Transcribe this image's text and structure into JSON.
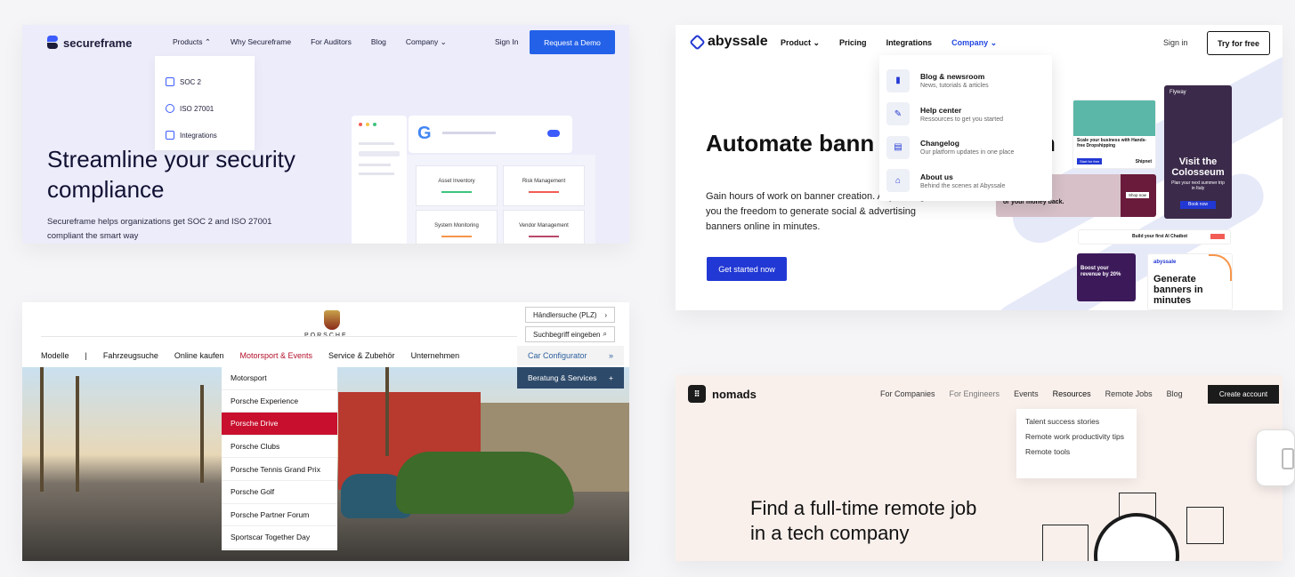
{
  "secureframe": {
    "brand": "secureframe",
    "nav": [
      "Products ⌃",
      "Why Secureframe",
      "For Auditors",
      "Blog",
      "Company ⌄"
    ],
    "sign_in": "Sign In",
    "cta": "Request a Demo",
    "dropdown": [
      "SOC 2",
      "ISO 27001",
      "Integrations"
    ],
    "headline": "Streamline your security compliance",
    "subtext": "Secureframe helps organizations get SOC 2 and ISO 27001 compliant the smart way",
    "tiles": [
      "Asset Inventory",
      "Risk Management",
      "System Monitoring",
      "Vendor Management"
    ],
    "colors": {
      "accent": "#2361e8",
      "bg": "#ececfa"
    }
  },
  "abyssale": {
    "brand": "abyssale",
    "nav": [
      "Product ⌄",
      "Pricing",
      "Integrations",
      "Company ⌄"
    ],
    "sign_in": "Sign in",
    "cta_top": "Try for free",
    "headline": "Automate bann production in m",
    "subtext": "Gain hours of work on banner creation. Abyssale gives you the freedom to generate social & advertising banners online in minutes.",
    "cta": "Get started now",
    "dropdown": [
      {
        "title": "Blog & newsroom",
        "desc": "News, tutorials & articles",
        "icon": "book-icon"
      },
      {
        "title": "Help center",
        "desc": "Ressources to get you started",
        "icon": "wrench-icon"
      },
      {
        "title": "Changelog",
        "desc": "Our platform updates in one place",
        "icon": "document-icon"
      },
      {
        "title": "About us",
        "desc": "Behind the scenes at Abyssale",
        "icon": "building-icon"
      }
    ],
    "banners": {
      "shipnet_title": "Scale your business with Hands-free Dropshipping",
      "shipnet_btn": "Start for free",
      "shipnet_brand": "Shipnet",
      "flyway_brand": "Flyway",
      "flyway_title": "Visit the Colosseum",
      "flyway_sub": "Plan your next summer trip in Italy",
      "flyway_btn": "Book now",
      "money_text": "or your money back.",
      "shop_btn": "Shop now",
      "vektor_text": "Build your first AI Chatbot",
      "boost_text": "Boost your revenue by 20%",
      "minutes_brand": "abyssale",
      "minutes_title": "Generate banners in minutes"
    },
    "colors": {
      "accent": "#2238d4",
      "active_nav": "#2448e0"
    }
  },
  "porsche": {
    "brand": "PORSCHE",
    "nav": [
      "Modelle",
      "|",
      "Fahrzeugsuche",
      "Online kaufen",
      "Motorsport & Events",
      "Service & Zubehör",
      "Unternehmen"
    ],
    "dealer_search": "Händlersuche (PLZ)",
    "search": "Suchbegriff eingeben",
    "configurator": "Car Configurator",
    "advice": "Beratung & Services",
    "dropdown": [
      "Motorsport",
      "Porsche Experience",
      "Porsche Drive",
      "Porsche Clubs",
      "Porsche Tennis Grand Prix",
      "Porsche Golf",
      "Porsche Partner Forum",
      "Sportscar Together Day"
    ],
    "highlighted": "Porsche Drive",
    "colors": {
      "accent": "#c8102e"
    }
  },
  "nomads": {
    "brand": "nomads",
    "nav": [
      "For Companies",
      "For Engineers",
      "Events",
      "Resources",
      "Remote Jobs",
      "Blog"
    ],
    "cta": "Create account",
    "dropdown": [
      "Talent success stories",
      "Remote work productivity tips",
      "Remote tools"
    ],
    "headline": "Find a full-time remote job in a tech company"
  }
}
